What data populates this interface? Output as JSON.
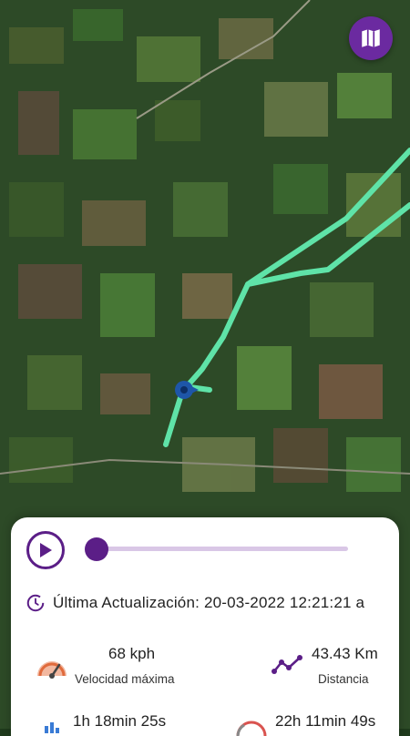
{
  "map": {
    "button_icon": "map-icon"
  },
  "player": {
    "play_icon": "play-icon",
    "progress": 0.0
  },
  "last_update": {
    "icon": "clock-refresh-icon",
    "text": "Última Actualización: 20-03-2022 12:21:21 a"
  },
  "stats": {
    "max_speed": {
      "icon": "speedometer-icon",
      "value": "68 kph",
      "label": "Velocidad máxima"
    },
    "distance": {
      "icon": "route-icon",
      "value": "43.43 Km",
      "label": "Distancia"
    },
    "time_moving": {
      "icon": "chart-icon",
      "value": "1h 18min 25s"
    },
    "time_stopped": {
      "icon": "timer-icon",
      "value": "22h 11min 49s"
    }
  },
  "colors": {
    "accent": "#5b1e87",
    "route": "#5fe3a8",
    "map_button": "#6b2aa0",
    "marker": "#1e56a8"
  }
}
